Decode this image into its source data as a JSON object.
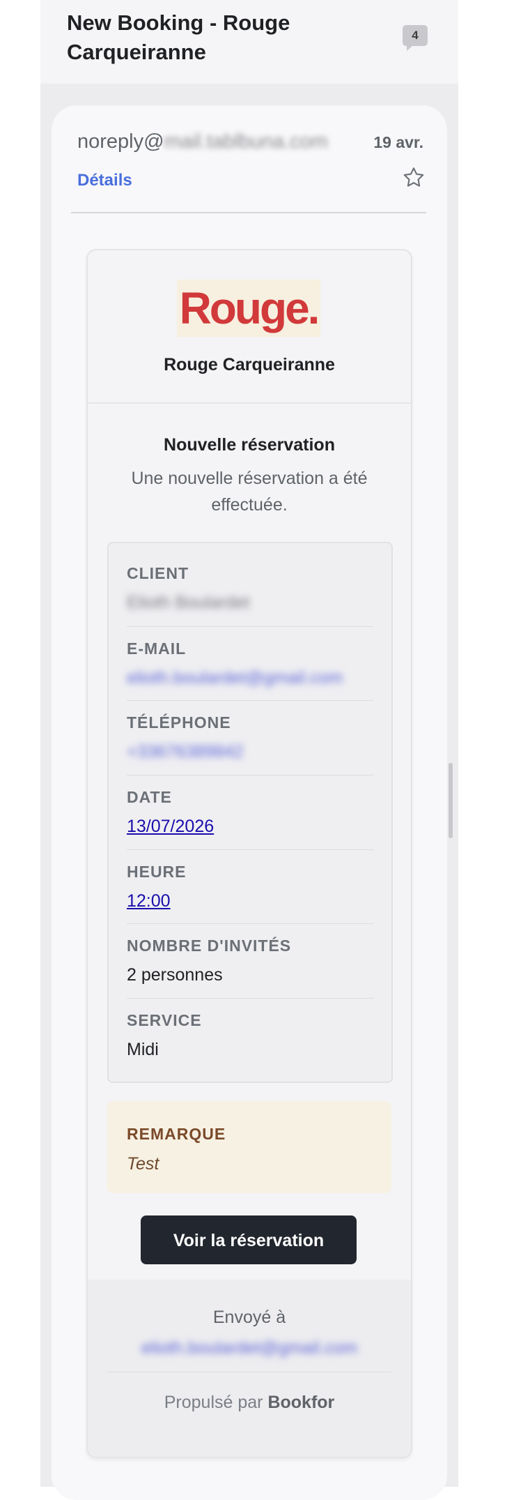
{
  "thread": {
    "subject": "New Booking - Rouge Carqueiranne",
    "message_count": "4"
  },
  "message": {
    "sender_prefix": "noreply@",
    "sender_domain_blurred": "mail.tablbuna.com",
    "date": "19 avr.",
    "details_label": "Détails"
  },
  "email": {
    "logo_text": "Rouge.",
    "restaurant_name": "Rouge Carqueiranne",
    "title": "Nouvelle réservation",
    "subtitle": "Une nouvelle réservation a été effectuée.",
    "fields": {
      "client": {
        "label": "CLIENT",
        "value": "Elioth Boulardet"
      },
      "email": {
        "label": "E-MAIL",
        "value": "elioth.boulardet@gmail.com"
      },
      "phone": {
        "label": "TÉLÉPHONE",
        "value": "+33676389842"
      },
      "date": {
        "label": "DATE",
        "value": "13/07/2026"
      },
      "time": {
        "label": "HEURE",
        "value": "12:00"
      },
      "guests": {
        "label": "NOMBRE D'INVITÉS",
        "value": "2 personnes"
      },
      "service": {
        "label": "SERVICE",
        "value": "Midi"
      }
    },
    "remark": {
      "label": "REMARQUE",
      "value": "Test"
    },
    "cta_label": "Voir la réservation",
    "footer": {
      "sent_to_label": "Envoyé à",
      "sent_to_email": "elioth.boulardet@gmail.com",
      "powered_prefix": "Propulsé par ",
      "powered_brand": "Bookfor"
    }
  },
  "colors": {
    "brand_red": "#d1393a",
    "link_blue": "#1a0dab",
    "details_blue": "#4a6fdc",
    "cta_dark": "#22262e",
    "remark_bg": "#f7f1e3"
  },
  "icons": {
    "star": "star-outline-icon",
    "count": "speech-bubble-badge"
  }
}
